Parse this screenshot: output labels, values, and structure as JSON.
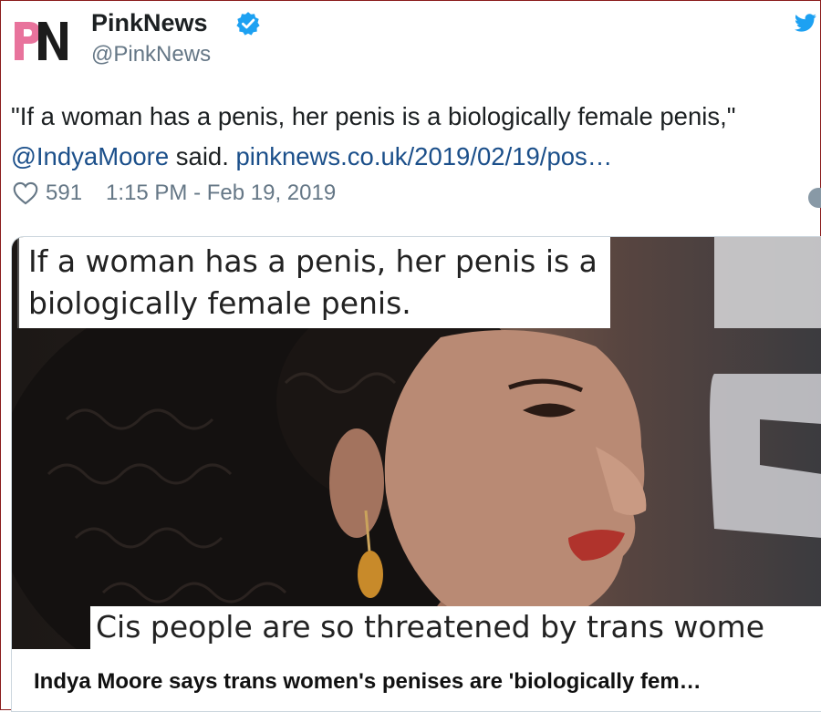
{
  "account": {
    "name": "PinkNews",
    "handle": "@PinkNews",
    "logo_text": "PN",
    "verified": true,
    "verified_icon": "verified-badge-icon",
    "platform_icon": "twitter-bird-icon"
  },
  "tweet": {
    "text_main": "\"If a woman has a penis, her penis is a biologically female penis,\"",
    "mention": "@IndyaMoore",
    "text_after_mention": "said.",
    "link": "pinknews.co.uk/2019/02/19/pos…",
    "likes": "591",
    "timestamp": "1:15 PM - Feb 19, 2019",
    "like_icon": "heart-icon"
  },
  "card": {
    "caption_top": "If a woman has a penis, her penis is a biologically female penis.",
    "caption_bottom": "Cis people are so threatened by trans wome",
    "title": "Indya Moore says trans women's penises are 'biologically fem…"
  },
  "colors": {
    "brand_pink": "#e8739c",
    "link_blue": "#1b4f8a",
    "verified_blue": "#1da1f2",
    "muted_gray": "#657786"
  }
}
